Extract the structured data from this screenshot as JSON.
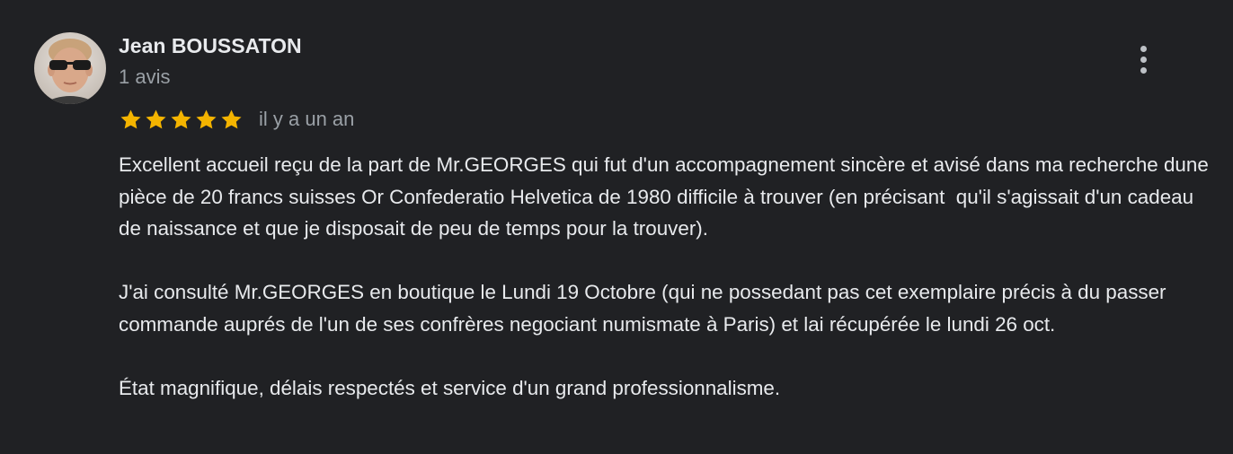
{
  "review": {
    "author": {
      "name": "Jean BOUSSATON",
      "meta": "1 avis",
      "avatar_icon": "user-photo-avatar"
    },
    "rating": {
      "stars": 5,
      "max": 5,
      "star_color": "#f4b400"
    },
    "date": "il y a un an",
    "menu_icon": "more-vert-icon",
    "paragraphs": [
      "Excellent accueil reçu de la part de Mr.GEORGES qui fut d'un accompagnement sincère et avisé dans ma recherche dune pièce de 20 francs suisses Or Confederatio Helvetica de 1980 difficile à trouver (en précisant  qu'il s'agissait d'un cadeau de naissance et que je disposait de peu de temps pour la trouver).",
      "J'ai consulté Mr.GEORGES en boutique le Lundi 19 Octobre (qui ne possedant pas cet exemplaire précis à du passer commande auprés de l'un de ses confrères negociant numismate à Paris) et lai récupérée le lundi 26 oct.",
      "État magnifique, délais respectés et service d'un grand professionnalisme."
    ]
  },
  "colors": {
    "background": "#202124",
    "text_primary": "#e8eaed",
    "text_secondary": "#9aa0a6"
  }
}
